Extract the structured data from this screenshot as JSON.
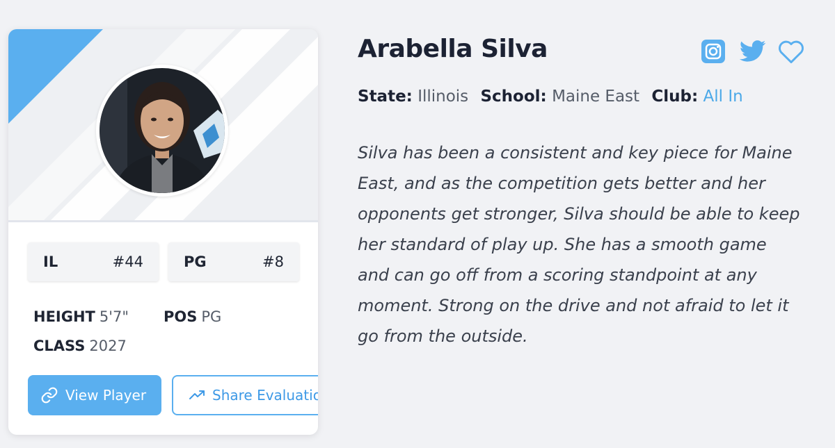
{
  "player": {
    "name": "Arabella Silva",
    "state_label": "State:",
    "state": "Illinois",
    "school_label": "School:",
    "school": "Maine East",
    "club_label": "Club:",
    "club": "All In",
    "bio": "Silva has been a consistent and key piece for Maine East, and as the competition gets better and her opponents get stronger, Silva should be able to keep her standard of play up. She has a smooth game and can go off from a scoring standpoint at any moment. Strong on the drive and not afraid to let it go from the outside."
  },
  "rankings": {
    "state_abbr": "IL",
    "state_rank": "#44",
    "position_abbr": "PG",
    "position_rank": "#8"
  },
  "stats": {
    "height_label": "HEIGHT",
    "height": "5'7\"",
    "pos_label": "POS",
    "pos": "PG",
    "class_label": "CLASS",
    "class": "2027"
  },
  "actions": {
    "view_player": "View Player",
    "share_evaluation": "Share Evaluation"
  },
  "icons": {
    "social": [
      "instagram-icon",
      "twitter-icon",
      "heart-icon"
    ],
    "buttons": [
      "link-icon",
      "trending-up-icon"
    ]
  },
  "colors": {
    "accent": "#5aafef",
    "link": "#4aa8e8",
    "background": "#f1f2f5",
    "card": "#ffffff",
    "text_dark": "#1c2233"
  }
}
